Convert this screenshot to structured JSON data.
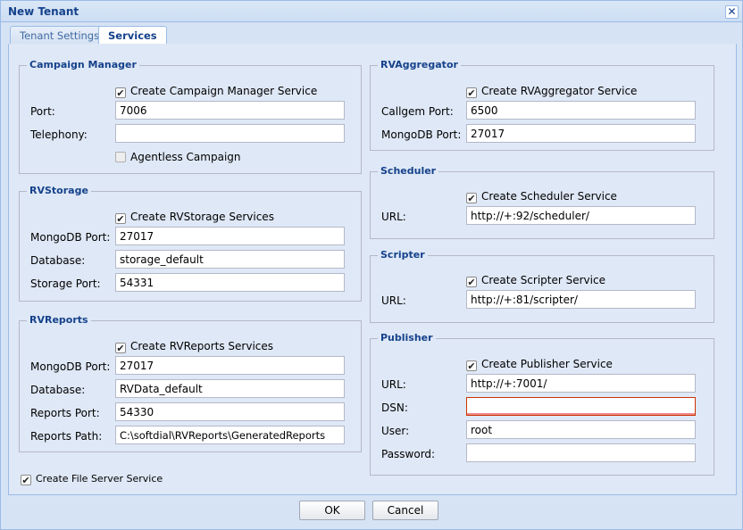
{
  "window": {
    "title": "New Tenant",
    "close_symbol": "✕"
  },
  "tabs": [
    {
      "label": "Tenant Settings",
      "active": false
    },
    {
      "label": "Services",
      "active": true
    }
  ],
  "campaign_manager": {
    "legend": "Campaign Manager",
    "create_label": "Create Campaign Manager Service",
    "create_checked": true,
    "port_label": "Port:",
    "port_value": "7006",
    "telephony_label": "Telephony:",
    "telephony_value": "",
    "agentless_label": "Agentless Campaign",
    "agentless_checked": false
  },
  "rvstorage": {
    "legend": "RVStorage",
    "create_label": "Create RVStorage Services",
    "create_checked": true,
    "mongodb_port_label": "MongoDB Port:",
    "mongodb_port_value": "27017",
    "database_label": "Database:",
    "database_value": "storage_default",
    "storage_port_label": "Storage Port:",
    "storage_port_value": "54331"
  },
  "rvreports": {
    "legend": "RVReports",
    "create_label": "Create RVReports Services",
    "create_checked": true,
    "mongodb_port_label": "MongoDB Port:",
    "mongodb_port_value": "27017",
    "database_label": "Database:",
    "database_value": "RVData_default",
    "reports_port_label": "Reports Port:",
    "reports_port_value": "54330",
    "reports_path_label": "Reports Path:",
    "reports_path_value": "C:\\softdial\\RVReports\\GeneratedReports"
  },
  "file_server": {
    "label": "Create File Server Service",
    "checked": true
  },
  "rvaggregator": {
    "legend": "RVAggregator",
    "create_label": "Create RVAggregator Service",
    "create_checked": true,
    "callgem_port_label": "Callgem Port:",
    "callgem_port_value": "6500",
    "mongodb_port_label": "MongoDB Port:",
    "mongodb_port_value": "27017"
  },
  "scheduler": {
    "legend": "Scheduler",
    "create_label": "Create Scheduler Service",
    "create_checked": true,
    "url_label": "URL:",
    "url_value": "http://+:92/scheduler/"
  },
  "scripter": {
    "legend": "Scripter",
    "create_label": "Create Scripter Service",
    "create_checked": true,
    "url_label": "URL:",
    "url_value": "http://+:81/scripter/"
  },
  "publisher": {
    "legend": "Publisher",
    "create_label": "Create Publisher Service",
    "create_checked": true,
    "url_label": "URL:",
    "url_value": "http://+:7001/",
    "dsn_label": "DSN:",
    "dsn_value": "",
    "user_label": "User:",
    "user_value": "root",
    "password_label": "Password:",
    "password_value": ""
  },
  "buttons": {
    "ok": "OK",
    "cancel": "Cancel"
  },
  "checkmark": "✔",
  "colors": {
    "title_text": "#15428b",
    "panel_bg": "#dfe8f6",
    "border": "#99bbe8",
    "invalid": "#cc3300"
  }
}
